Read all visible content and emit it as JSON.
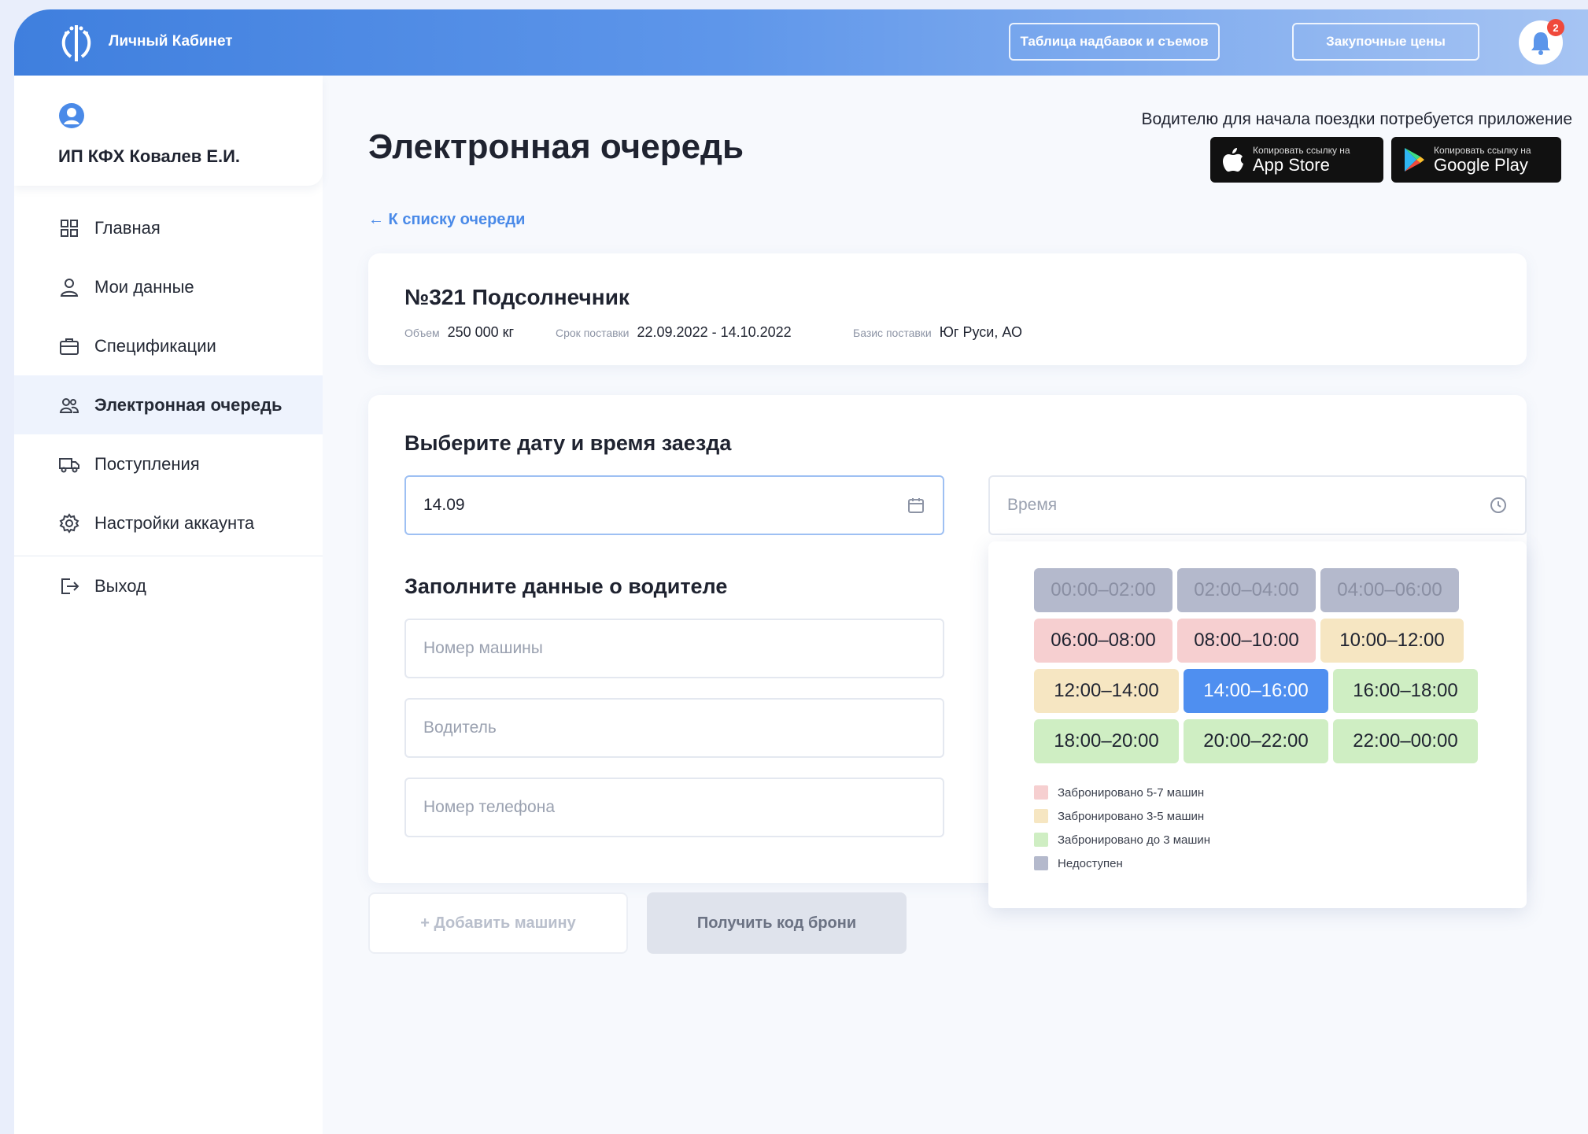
{
  "header": {
    "brand": "Личный Кабинет",
    "buttons": [
      "Таблица надбавок и съемов",
      "Закупочные цены"
    ],
    "notification_count": "2"
  },
  "profile": {
    "name": "ИП КФХ Ковалев Е.И."
  },
  "sidebar": {
    "items": [
      {
        "label": "Главная",
        "icon": "grid-icon"
      },
      {
        "label": "Мои данные",
        "icon": "user-icon"
      },
      {
        "label": "Спецификации",
        "icon": "briefcase-icon"
      },
      {
        "label": "Электронная очередь",
        "icon": "users-icon",
        "active": true
      },
      {
        "label": "Поступления",
        "icon": "truck-icon"
      },
      {
        "label": "Настройки аккаунта",
        "icon": "gear-icon"
      }
    ],
    "logout": {
      "label": "Выход",
      "icon": "logout-icon"
    }
  },
  "main": {
    "title": "Электронная очередь",
    "app_note": "Водителю для начала поездки потребуется приложение",
    "stores": [
      {
        "small": "Копировать ссылку на",
        "big": "App Store",
        "icon": "apple-icon"
      },
      {
        "small": "Копировать ссылку на",
        "big": "Google Play",
        "icon": "google-play-icon"
      }
    ],
    "back_link": "← К списку очереди",
    "lot": {
      "title": "№321 Подсолнечник",
      "volume_label": "Объем",
      "volume": "250 000 кг",
      "period_label": "Срок поставки",
      "period": "22.09.2022 - 14.10.2022",
      "basis_label": "Базис поставки",
      "basis": "Юг Руси, АО"
    },
    "date_section": {
      "title": "Выберите дату и время заезда",
      "date_value": "14.09",
      "time_placeholder": "Время"
    },
    "driver_section": {
      "title": "Заполните данные о водителе",
      "car_placeholder": "Номер машины",
      "driver_placeholder": "Водитель",
      "phone_placeholder": "Номер телефона"
    },
    "time_slots": [
      {
        "label": "00:00–02:00",
        "status": "unavailable"
      },
      {
        "label": "02:00–04:00",
        "status": "unavailable"
      },
      {
        "label": "04:00–06:00",
        "status": "unavailable"
      },
      {
        "label": "06:00–08:00",
        "status": "booked-5-7"
      },
      {
        "label": "08:00–10:00",
        "status": "booked-5-7"
      },
      {
        "label": "10:00–12:00",
        "status": "booked-3-5"
      },
      {
        "label": "12:00–14:00",
        "status": "booked-3-5"
      },
      {
        "label": "14:00–16:00",
        "status": "selected"
      },
      {
        "label": "16:00–18:00",
        "status": "booked-up-to-3"
      },
      {
        "label": "18:00–20:00",
        "status": "booked-up-to-3"
      },
      {
        "label": "20:00–22:00",
        "status": "booked-up-to-3"
      },
      {
        "label": "22:00–00:00",
        "status": "booked-up-to-3"
      }
    ],
    "legend": [
      {
        "label": "Забронировано 5-7 машин",
        "color": "#f6cfd0"
      },
      {
        "label": "Забронировано 3-5 машин",
        "color": "#f6e6c2"
      },
      {
        "label": "Забронировано до 3 машин",
        "color": "#cfeec3"
      },
      {
        "label": "Недоступен",
        "color": "#b4b9cc"
      }
    ],
    "add_car_button": "+ Добавить машину",
    "get_code_button": "Получить код брони"
  },
  "colors": {
    "accent": "#4a8ae8",
    "selected_slot": "#4f8ff0",
    "unavailable_slot": "#b4b9cc"
  }
}
